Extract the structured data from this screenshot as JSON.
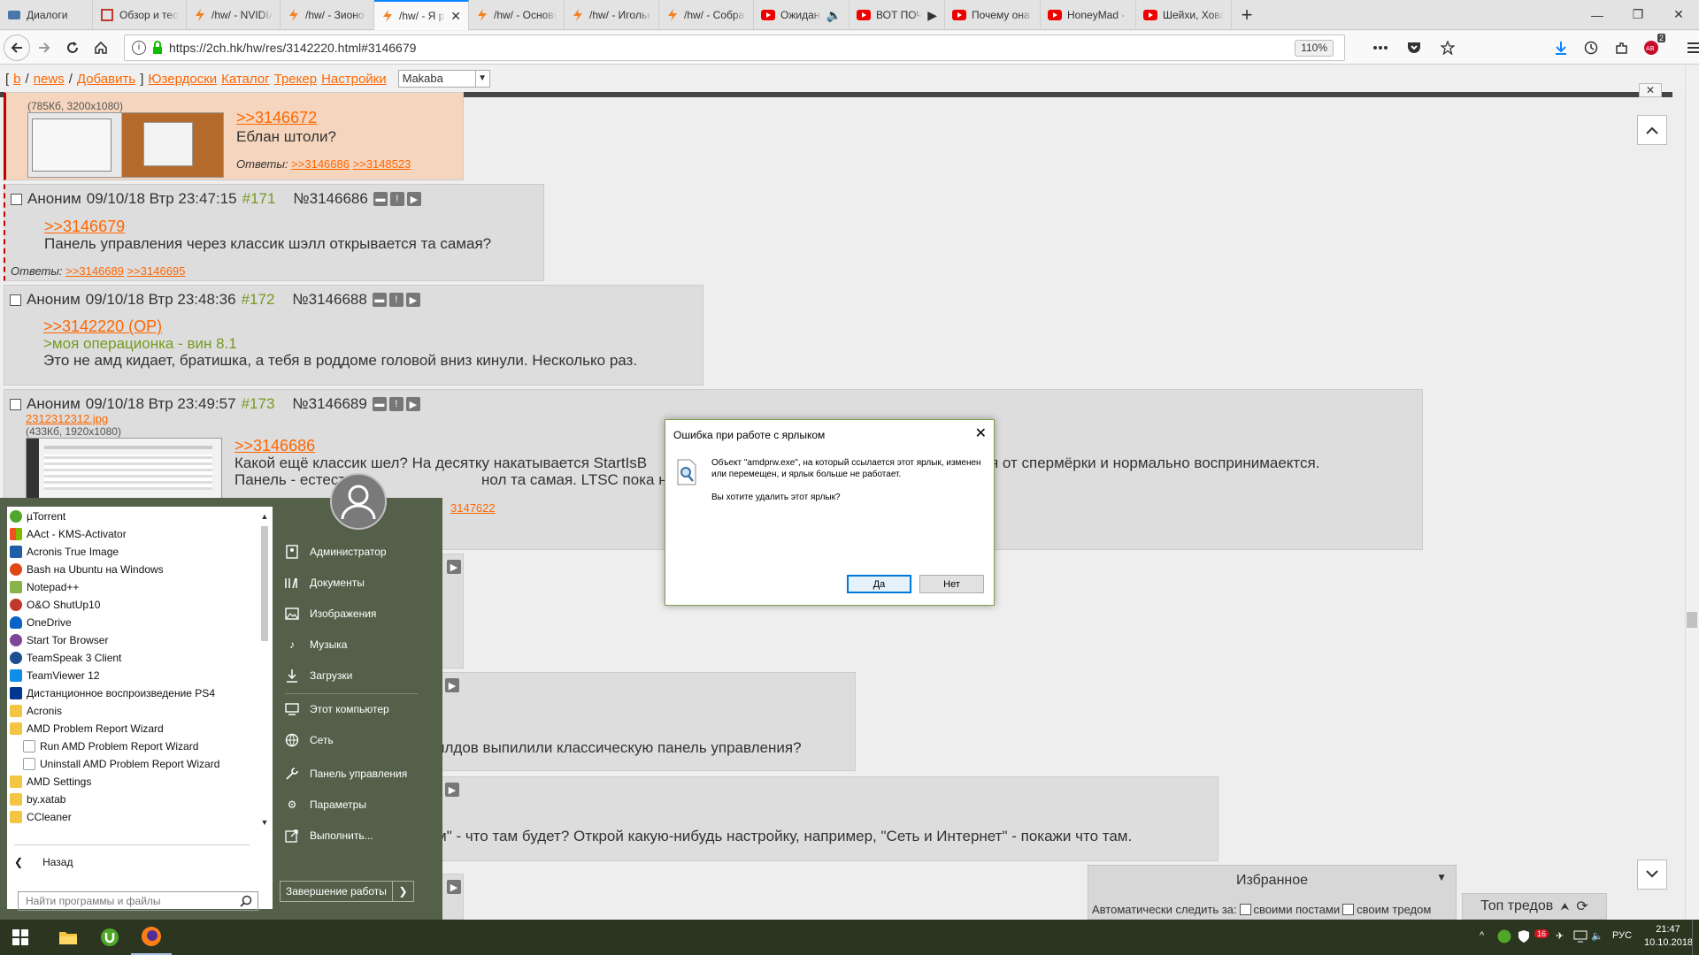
{
  "browser": {
    "tabs": [
      {
        "title": "Диалоги",
        "icon": "dialogs-icon",
        "active": false
      },
      {
        "title": "Обзор и тестир",
        "icon": "review-icon",
        "active": false
      },
      {
        "title": "/hw/ - NVIDIA T",
        "icon": "lightning-icon",
        "active": false
      },
      {
        "title": "/hw/ - ЗионоТр",
        "icon": "lightning-icon",
        "active": false
      },
      {
        "title": "/hw/ - Я разо",
        "icon": "lightning-icon",
        "active": true
      },
      {
        "title": "/hw/ - Основно",
        "icon": "lightning-icon",
        "active": false
      },
      {
        "title": "/hw/ - Игольно",
        "icon": "lightning-icon",
        "active": false
      },
      {
        "title": "/hw/ - Собрал т",
        "icon": "lightning-icon",
        "active": false
      },
      {
        "title": "Ожидание и",
        "icon": "youtube-icon",
        "active": false
      },
      {
        "title": "ВОТ ПОЧЕМ",
        "icon": "youtube-icon",
        "active": false
      },
      {
        "title": "Почему она УШ",
        "icon": "youtube-icon",
        "active": false
      },
      {
        "title": "HoneyMad - You",
        "icon": "youtube-icon",
        "active": false
      },
      {
        "title": "Шейхи, Хован, А",
        "icon": "youtube-icon",
        "active": false
      }
    ],
    "url": "https://2ch.hk/hw/res/3142220.html#3146679",
    "zoom": "110%",
    "addon_badge": "2"
  },
  "boardnav": {
    "links": [
      "b",
      "news",
      "Добавить",
      "Юзердоски",
      "Каталог",
      "Трекер",
      "Настройки"
    ],
    "separators": [
      "[",
      "/",
      "/",
      "]"
    ],
    "style_select": "Makaba"
  },
  "posts": {
    "p170": {
      "fileinfo": "(785Кб, 3200x1080)",
      "ref": ">>3146672",
      "text": "Еблан штоли?",
      "replies_label": "Ответы:",
      "replies": [
        ">>3146686",
        ">>3148523"
      ]
    },
    "p171": {
      "author": "Аноним",
      "date": "09/10/18 Втр 23:47:15",
      "num": "#171",
      "id": "№3146686",
      "ref": ">>3146679",
      "text": "Панель управления через классик шэлл открывается та самая?",
      "replies_label": "Ответы:",
      "replies": [
        ">>3146689",
        ">>3146695"
      ]
    },
    "p172": {
      "author": "Аноним",
      "date": "09/10/18 Втр 23:48:36",
      "num": "#172",
      "id": "№3146688",
      "ref": ">>3142220 (OP)",
      "greentext": ">моя операционка - вин 8.1",
      "text": "Это не амд кидает, братишка, а тебя в роддоме головой вниз кинули. Несколько раз."
    },
    "p173": {
      "author": "Аноним",
      "date": "09/10/18 Втр 23:49:57",
      "num": "#173",
      "id": "№3146689",
      "filename": "2312312312.jpg",
      "fileinfo": "(433Кб, 1920x1080)",
      "ref": ">>3146686",
      "line1": "Какой ещё классик шел? На десятку накатывается StartIsB",
      "line1b": "ется от спермёрки и нормально воспринимаектся.",
      "line2": "Панель - естест",
      "line2b": "нол та самая. LTSC пока не смотрел...",
      "reply_partial": "3147622"
    },
    "p175": {
      "text_partial": "илдов выпилили классическую панель управления?"
    },
    "p176": {
      "text_partial": "м\" - что там будет? Открой какую-нибудь настройку, например, \"Сеть и Интернет\" - покажи что там."
    }
  },
  "favorites": {
    "title": "Избранное",
    "autowatch_label": "Автоматически следить за:",
    "opt_posts": "своими постами",
    "opt_threads": "своим тредом"
  },
  "top_threads": "Топ тредов",
  "start_menu": {
    "apps": [
      {
        "label": "µTorrent",
        "color": "#4fa72a",
        "sub": false
      },
      {
        "label": "AAct - KMS-Activator",
        "color": "#e74c3c",
        "sub": false
      },
      {
        "label": "Acronis True Image",
        "color": "#1f5fa8",
        "sub": false
      },
      {
        "label": "Bash на Ubuntu на Windows",
        "color": "#dd4814",
        "sub": false
      },
      {
        "label": "Notepad++",
        "color": "#8ab34a",
        "sub": false
      },
      {
        "label": "O&O ShutUp10",
        "color": "#c0392b",
        "sub": false
      },
      {
        "label": "OneDrive",
        "color": "#0a64c8",
        "sub": false
      },
      {
        "label": "Start Tor Browser",
        "color": "#7d4698",
        "sub": false
      },
      {
        "label": "TeamSpeak 3 Client",
        "color": "#1b4f8f",
        "sub": false
      },
      {
        "label": "TeamViewer 12",
        "color": "#0e8ee9",
        "sub": false
      },
      {
        "label": "Дистанционное воспроизведение PS4",
        "color": "#003791",
        "sub": false
      },
      {
        "label": "Acronis",
        "color": "#f4c542",
        "sub": false
      },
      {
        "label": "AMD Problem Report Wizard",
        "color": "#f4c542",
        "sub": false
      },
      {
        "label": "Run AMD Problem Report Wizard",
        "color": "#9aa0a6",
        "sub": true
      },
      {
        "label": "Uninstall AMD Problem Report Wizard",
        "color": "#9aa0a6",
        "sub": true
      },
      {
        "label": "AMD Settings",
        "color": "#f4c542",
        "sub": false
      },
      {
        "label": "by.xatab",
        "color": "#f4c542",
        "sub": false
      },
      {
        "label": "CCleaner",
        "color": "#f4c542",
        "sub": false
      }
    ],
    "back": "Назад",
    "search_placeholder": "Найти программы и файлы",
    "right": [
      {
        "label": "Администратор",
        "icon": "user-folder-icon"
      },
      {
        "label": "Документы",
        "icon": "documents-icon"
      },
      {
        "label": "Изображения",
        "icon": "pictures-icon"
      },
      {
        "label": "Музыка",
        "icon": "music-icon"
      },
      {
        "label": "Загрузки",
        "icon": "downloads-icon"
      },
      {
        "label": "Этот компьютер",
        "icon": "computer-icon"
      },
      {
        "label": "Сеть",
        "icon": "network-icon"
      },
      {
        "label": "Панель управления",
        "icon": "control-panel-icon"
      },
      {
        "label": "Параметры",
        "icon": "settings-icon"
      },
      {
        "label": "Выполнить...",
        "icon": "run-icon"
      }
    ],
    "shutdown": "Завершение работы"
  },
  "dialog": {
    "title": "Ошибка при работе с ярлыком",
    "message": "Объект \"amdprw.exe\", на который ссылается этот ярлык, изменен или перемещен, и ярлык больше не работает.",
    "question": "Вы хотите удалить этот ярлык?",
    "yes": "Да",
    "no": "Нет"
  },
  "taskbar": {
    "lang": "РУС",
    "time": "21:47",
    "date": "10.10.2018",
    "tray_badge": "16"
  },
  "colors": {
    "link": "#ff6600",
    "greentext": "#789922",
    "post_bg": "#dddddd",
    "highlight_bg": "#f5d5bd",
    "start_menu_bg": "#55604a",
    "taskbar_bg": "#2b3520",
    "accent": "#0078d7"
  }
}
